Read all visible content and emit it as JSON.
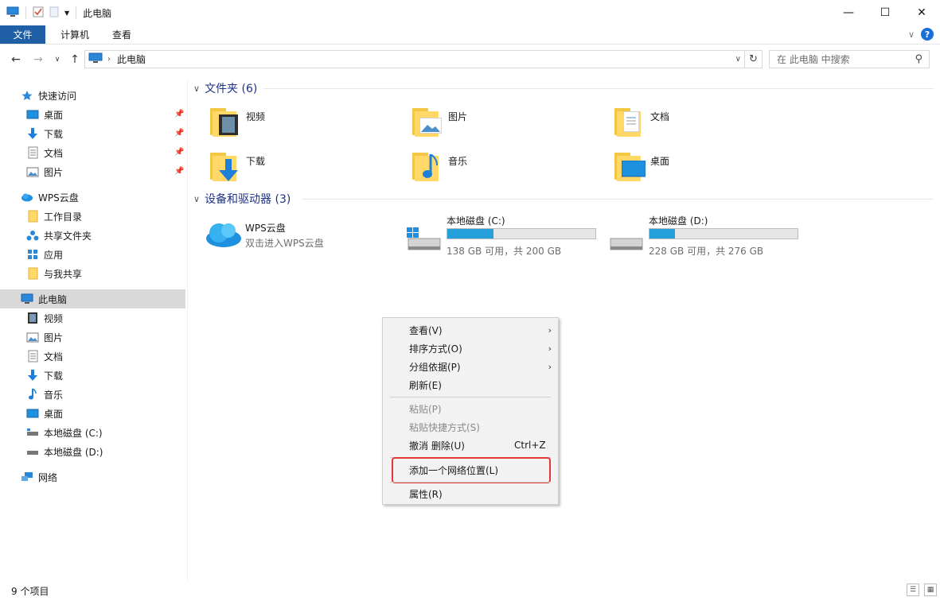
{
  "window": {
    "title": "此电脑",
    "controls": {
      "minimize": "—",
      "maximize": "☐",
      "close": "✕"
    }
  },
  "ribbon": {
    "tabs": [
      "文件",
      "计算机",
      "查看"
    ],
    "help": "?"
  },
  "address": {
    "path": "此电脑",
    "search_placeholder": "在 此电脑 中搜索"
  },
  "nav": {
    "quick_access": {
      "label": "快速访问",
      "items": [
        "桌面",
        "下载",
        "文档",
        "图片"
      ]
    },
    "wps": {
      "label": "WPS云盘",
      "items": [
        "工作目录",
        "共享文件夹",
        "应用",
        "与我共享"
      ]
    },
    "this_pc": {
      "label": "此电脑",
      "items": [
        "视频",
        "图片",
        "文档",
        "下载",
        "音乐",
        "桌面",
        "本地磁盘 (C:)",
        "本地磁盘 (D:)"
      ]
    },
    "network": "网络"
  },
  "content": {
    "folders_header": "文件夹 (6)",
    "folders": [
      "视频",
      "图片",
      "文档",
      "下载",
      "音乐",
      "桌面"
    ],
    "devices_header": "设备和驱动器 (3)",
    "wps_drive": {
      "name": "WPS云盘",
      "subtitle": "双击进入WPS云盘"
    },
    "drives": [
      {
        "name": "本地磁盘 (C:)",
        "free_text": "138 GB 可用，共 200 GB",
        "used_fraction": 0.31
      },
      {
        "name": "本地磁盘 (D:)",
        "free_text": "228 GB 可用，共 276 GB",
        "used_fraction": 0.174
      }
    ]
  },
  "context_menu": {
    "view": "查看(V)",
    "sort": "排序方式(O)",
    "group": "分组依据(P)",
    "refresh": "刷新(E)",
    "paste": "粘贴(P)",
    "paste_shortcut": "粘贴快捷方式(S)",
    "undo": "撤消 删除(U)",
    "undo_shortcut": "Ctrl+Z",
    "add_network": "添加一个网络位置(L)",
    "properties": "属性(R)"
  },
  "status": {
    "count": "9 个项目"
  },
  "colors": {
    "accent": "#1f5fa6",
    "drive_fill": "#26a0da",
    "highlight": "#e53935",
    "folder": "#ffd868"
  }
}
